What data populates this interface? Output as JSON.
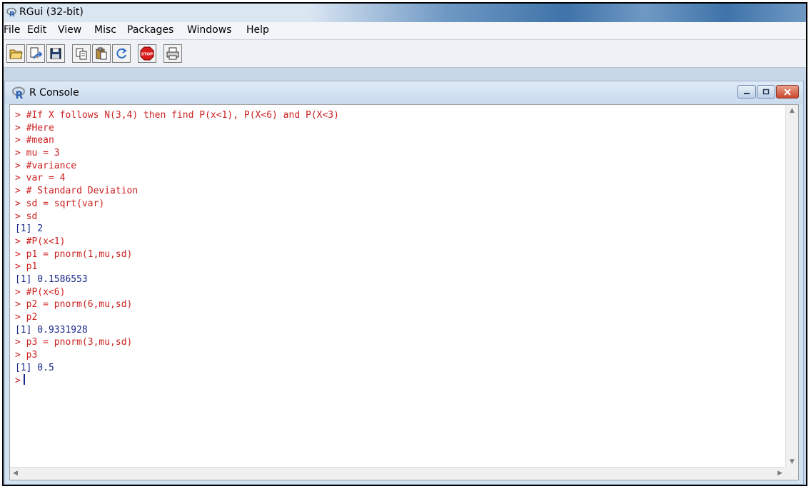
{
  "window": {
    "title": "RGui (32-bit)"
  },
  "menu": [
    "File",
    "Edit",
    "View",
    "Misc",
    "Packages",
    "Windows",
    "Help"
  ],
  "toolbar": {
    "buttons": [
      "open-script-icon",
      "load-workspace-icon",
      "save-workspace-icon",
      "copy-icon",
      "paste-icon",
      "copy-paste-icon",
      "stop-icon",
      "print-icon"
    ],
    "stop_label": "STOP"
  },
  "console": {
    "title": "R Console",
    "lines": [
      {
        "text": "> #If X follows N(3,4) then find P(x<1), P(X<6) and P(X<3)",
        "kind": "cmd"
      },
      {
        "text": "> #Here",
        "kind": "cmd"
      },
      {
        "text": "> #mean",
        "kind": "cmd"
      },
      {
        "text": "> mu = 3",
        "kind": "cmd"
      },
      {
        "text": "> #variance",
        "kind": "cmd"
      },
      {
        "text": "> var = 4",
        "kind": "cmd"
      },
      {
        "text": "> # Standard Deviation",
        "kind": "cmd"
      },
      {
        "text": "> sd = sqrt(var)",
        "kind": "cmd"
      },
      {
        "text": "> sd",
        "kind": "cmd"
      },
      {
        "text": "[1] 2",
        "kind": "out"
      },
      {
        "text": "> #P(x<1)",
        "kind": "cmd"
      },
      {
        "text": "> p1 = pnorm(1,mu,sd)",
        "kind": "cmd"
      },
      {
        "text": "> p1",
        "kind": "cmd"
      },
      {
        "text": "[1] 0.1586553",
        "kind": "out"
      },
      {
        "text": "> #P(x<6)",
        "kind": "cmd"
      },
      {
        "text": "> p2 = pnorm(6,mu,sd)",
        "kind": "cmd"
      },
      {
        "text": "> p2",
        "kind": "cmd"
      },
      {
        "text": "[1] 0.9331928",
        "kind": "out"
      },
      {
        "text": "> p3 = pnorm(3,mu,sd)",
        "kind": "cmd"
      },
      {
        "text": "> p3",
        "kind": "cmd"
      },
      {
        "text": "[1] 0.5",
        "kind": "out"
      }
    ],
    "prompt": ">"
  },
  "colors": {
    "command": "#cc1f1f",
    "output": "#1a2a8a"
  }
}
